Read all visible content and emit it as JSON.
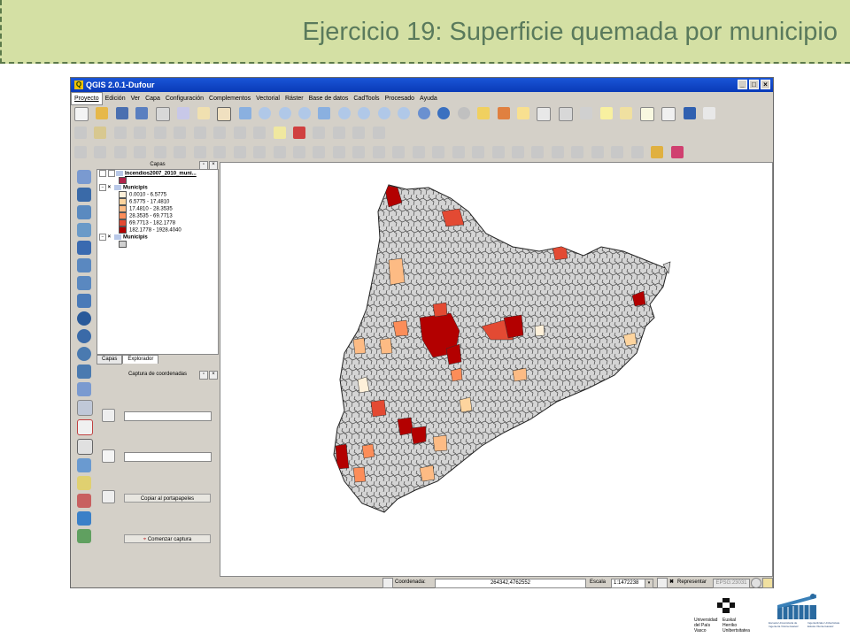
{
  "slide": {
    "title": "Ejercicio 19: Superficie quemada por municipio"
  },
  "window": {
    "title": "QGIS 2.0.1-Dufour",
    "minimize": "_",
    "maximize": "□",
    "close": "×"
  },
  "menu": [
    "Proyecto",
    "Edición",
    "Ver",
    "Capa",
    "Configuración",
    "Complementos",
    "Vectorial",
    "Ráster",
    "Base de datos",
    "CadTools",
    "Procesado",
    "Ayuda"
  ],
  "layers_panel": {
    "title": "Capas",
    "layer1": "Incendios2007_2010_muni...",
    "group": "Municipis",
    "legend": [
      "0.0010 - 6.5775",
      "6.5775 - 17.4810",
      "17.4810 - 28.3535",
      "28.3535 - 69.7713",
      "69.7713 - 182.1778",
      "182.1778 - 1928.4040"
    ],
    "legend_colors": [
      "#fef0d9",
      "#fdd49e",
      "#fdbb84",
      "#fc8d59",
      "#e34a33",
      "#b30000"
    ],
    "layer3": "Municipis",
    "tabs": [
      "Capas",
      "Explorador"
    ]
  },
  "coord_panel": {
    "title": "Captura de coordenadas",
    "copy_button": "Copiar al portapapeles",
    "start_button": "Comenzar captura"
  },
  "status": {
    "coord_label": "Coordenada:",
    "coord_value": "264342,4762552",
    "scale_label": "Escala",
    "scale_value": "1:1472238",
    "render_label": "Representar",
    "crs": "EPSG:23031"
  },
  "footer": {
    "upv_line1": "Universidad",
    "upv_line2": "del País Vasco",
    "ehu_line1": "Euskal Herriko",
    "ehu_line2": "Unibertsitatea",
    "school_left": "Escuela Universitaria de Ingeniería Vitoria-Gasteiz",
    "school_right": "Ingeniaritzako Unibertsitate Eskola Vitoria-Gasteiz"
  }
}
